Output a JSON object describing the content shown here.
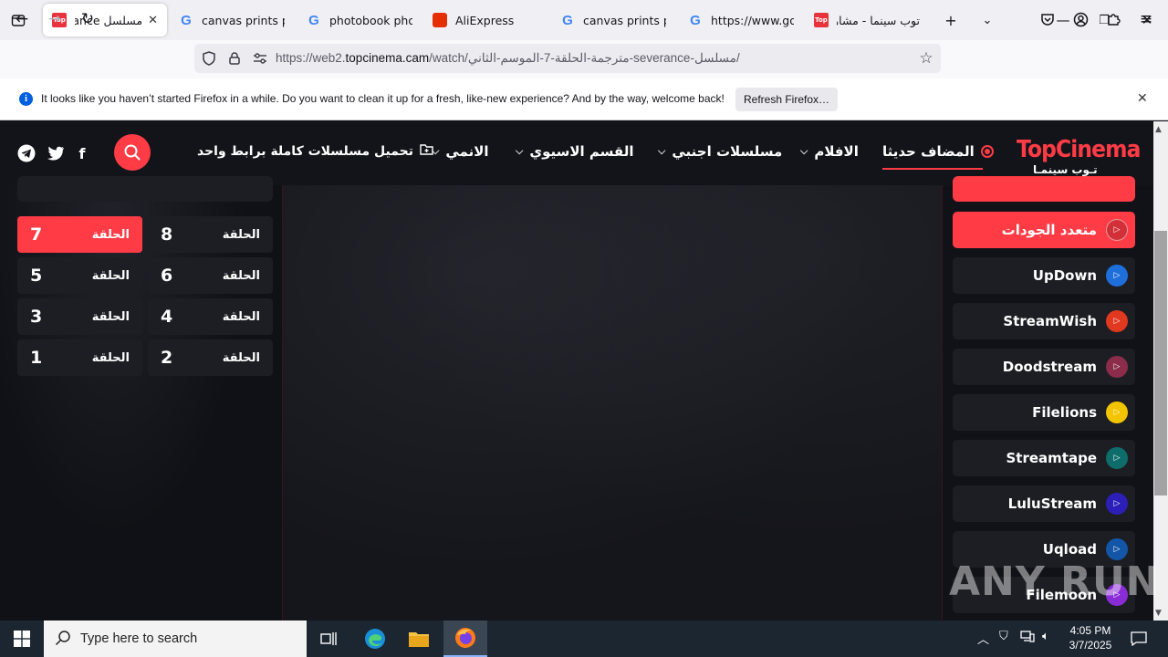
{
  "browser": {
    "tabs": [
      {
        "title": "مسلسل Severance",
        "favicon": "topcinema-favicon",
        "active": true
      },
      {
        "title": "canvas prints phot",
        "favicon": "google-favicon"
      },
      {
        "title": "photobook photob",
        "favicon": "google-favicon"
      },
      {
        "title": "AliExpress",
        "favicon": "aliexpress-favicon"
      },
      {
        "title": "canvas prints phot",
        "favicon": "google-favicon"
      },
      {
        "title": "https://www.goog",
        "favicon": "google-favicon"
      },
      {
        "title": "توب سينما - مشاهد",
        "favicon": "topcinema-favicon"
      }
    ],
    "url_prefix": "https://web2.",
    "url_domain": "topcinema.cam",
    "url_path": "/مسلسل-severance-مترجمة-الحلقة-7-الموسم-الثاني/watch/",
    "notification": {
      "text": "It looks like you haven’t started Firefox in a while. Do you want to clean it up for a fresh, like-new experience? And by the way, welcome back!",
      "button": "Refresh Firefox…"
    }
  },
  "site": {
    "logo_en": "TopCinema",
    "logo_ar": "تـوب سينمـا",
    "menu": [
      {
        "label": "المضاف حديثا",
        "active": true
      },
      {
        "label": "الافلام",
        "dropdown": true
      },
      {
        "label": "مسلسلات اجنبي",
        "dropdown": true
      },
      {
        "label": "القسم الاسيوي",
        "dropdown": true
      },
      {
        "label": "الانمي",
        "dropdown": true
      },
      {
        "label": "تحميل مسلسلات كاملة برابط واحد"
      }
    ],
    "episode_label": "الحلقة",
    "episodes": [
      {
        "num": "8",
        "active": false
      },
      {
        "num": "7",
        "active": true
      },
      {
        "num": "6",
        "active": false
      },
      {
        "num": "5",
        "active": false
      },
      {
        "num": "4",
        "active": false
      },
      {
        "num": "3",
        "active": false
      },
      {
        "num": "2",
        "active": false
      },
      {
        "num": "1",
        "active": false
      }
    ],
    "servers": [
      {
        "name": "متعدد الجودات",
        "color": "#ff3b45",
        "active": true
      },
      {
        "name": "UpDown",
        "color": "#1e6fd9"
      },
      {
        "name": "StreamWish",
        "color": "#e0391f"
      },
      {
        "name": "Doodstream",
        "color": "#8a2c4a"
      },
      {
        "name": "Filelions",
        "color": "#f2c500"
      },
      {
        "name": "Streamtape",
        "color": "#0e6d6a"
      },
      {
        "name": "LuluStream",
        "color": "#2b1fb8"
      },
      {
        "name": "Uqload",
        "color": "#1356a8"
      },
      {
        "name": "Filemoon",
        "color": "#8a2cd6"
      }
    ],
    "accent": "#ff3b45"
  },
  "watermark": "ANY RUN",
  "taskbar": {
    "search_placeholder": "Type here to search",
    "time": "4:05 PM",
    "date": "3/7/2025"
  }
}
